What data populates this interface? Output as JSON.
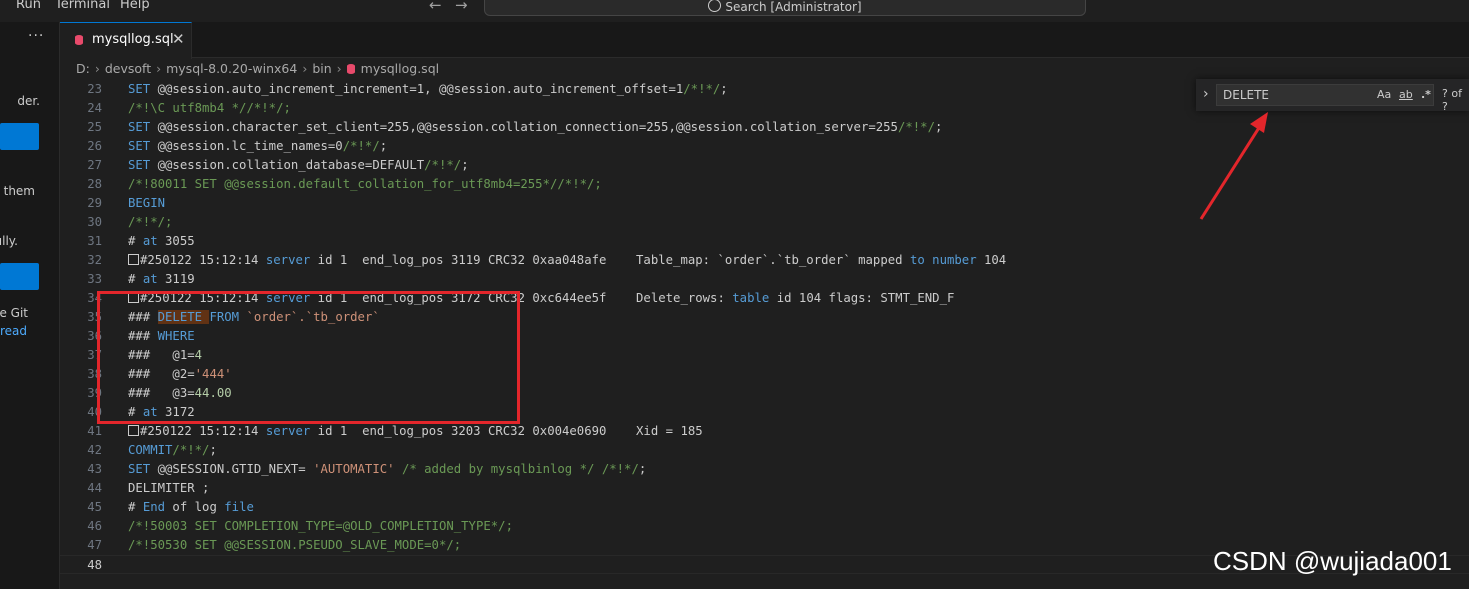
{
  "menu": {
    "items": [
      "Run",
      "Terminal",
      "Help"
    ],
    "back_icon": "arrow-left-icon",
    "forward_icon": "arrow-right-icon",
    "search_label": "Search [Administrator]"
  },
  "sidebar": {
    "more_label": "···",
    "text_fragments": [
      "der.",
      "o them",
      "ully.",
      "e Git",
      "read"
    ]
  },
  "tab": {
    "label": "mysqllog.sql",
    "close_label": "✕",
    "icon": "database-icon"
  },
  "breadcrumb": [
    "D:",
    "devsoft",
    "mysql-8.0.20-winx64",
    "bin",
    "mysqllog.sql"
  ],
  "editor": {
    "lines": [
      {
        "n": "23",
        "text": "SET @@session.auto_increment_increment=1, @@session.auto_increment_offset=1/*!*/;"
      },
      {
        "n": "24",
        "text": "/*!\\C utf8mb4 *//*!*/;"
      },
      {
        "n": "25",
        "text": "SET @@session.character_set_client=255,@@session.collation_connection=255,@@session.collation_server=255/*!*/;"
      },
      {
        "n": "26",
        "text": "SET @@session.lc_time_names=0/*!*/;"
      },
      {
        "n": "27",
        "text": "SET @@session.collation_database=DEFAULT/*!*/;"
      },
      {
        "n": "28",
        "text": "/*!80011 SET @@session.default_collation_for_utf8mb4=255*//*!*/;"
      },
      {
        "n": "29",
        "text": "BEGIN"
      },
      {
        "n": "30",
        "text": "/*!*/;"
      },
      {
        "n": "31",
        "text": "# at 3055"
      },
      {
        "n": "32",
        "text": "#250122 15:12:14 server id 1  end_log_pos 3119 CRC32 0xaa048afe    Table_map: `order`.`tb_order` mapped to number 104"
      },
      {
        "n": "33",
        "text": "# at 3119"
      },
      {
        "n": "34",
        "text": "#250122 15:12:14 server id 1  end_log_pos 3172 CRC32 0xc644ee5f    Delete_rows: table id 104 flags: STMT_END_F"
      },
      {
        "n": "35",
        "text": "### DELETE FROM `order`.`tb_order`"
      },
      {
        "n": "36",
        "text": "### WHERE"
      },
      {
        "n": "37",
        "text": "###   @1=4"
      },
      {
        "n": "38",
        "text": "###   @2='444'"
      },
      {
        "n": "39",
        "text": "###   @3=44.00"
      },
      {
        "n": "40",
        "text": "# at 3172"
      },
      {
        "n": "41",
        "text": "#250122 15:12:14 server id 1  end_log_pos 3203 CRC32 0x004e0690    Xid = 185"
      },
      {
        "n": "42",
        "text": "COMMIT/*!*/;"
      },
      {
        "n": "43",
        "text": "SET @@SESSION.GTID_NEXT= 'AUTOMATIC' /* added by mysqlbinlog */ /*!*/;"
      },
      {
        "n": "44",
        "text": "DELIMITER ;"
      },
      {
        "n": "45",
        "text": "# End of log file"
      },
      {
        "n": "46",
        "text": "/*!50003 SET COMPLETION_TYPE=@OLD_COMPLETION_TYPE*/;"
      },
      {
        "n": "47",
        "text": "/*!50530 SET @@SESSION.PSEUDO_SLAVE_MODE=0*/;"
      },
      {
        "n": "48",
        "text": ""
      }
    ]
  },
  "find": {
    "value": "DELETE",
    "match_case": "Aa",
    "whole_word": "ab",
    "regex": ".*",
    "count": "? of ?",
    "toggle_icon": "chevron-right-icon"
  },
  "watermark": "CSDN @wujiada001",
  "colors": {
    "accent": "#0078d4",
    "annotation_red": "#e3262b",
    "highlight": "#613214"
  }
}
